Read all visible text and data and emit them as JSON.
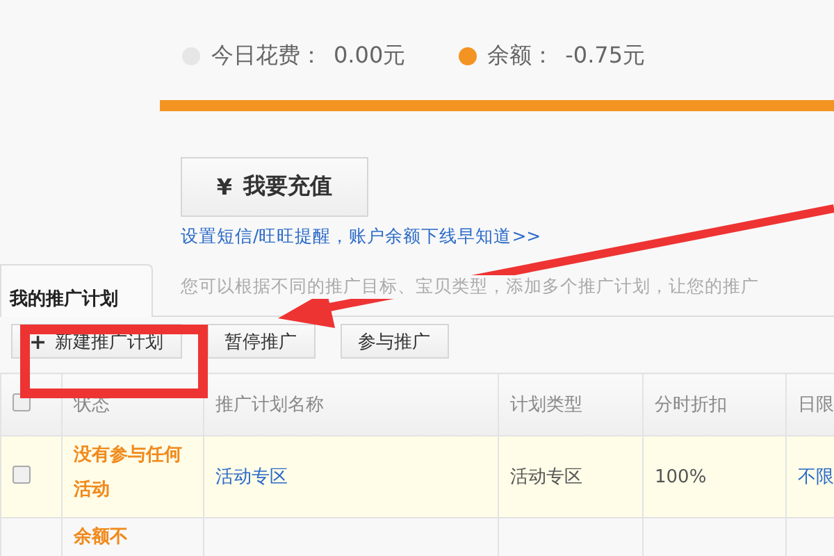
{
  "stats": [
    {
      "label": "今日花费：",
      "value": "0.00元",
      "color": "#e6e6e6"
    },
    {
      "label": "余额：",
      "value": "-0.75元",
      "color": "#f39422"
    }
  ],
  "recharge_button": {
    "icon": "¥",
    "label": "我要充值"
  },
  "reminder_link": "设置短信/旺旺提醒，账户余额下线早知道>>",
  "tabs": [
    {
      "label": "我的推广计划",
      "selected": true
    }
  ],
  "tab_hint": "您可以根据不同的推广目标、宝贝类型，添加多个推广计划，让您的推广",
  "toolbar": [
    {
      "icon": "+",
      "label": "新建推广计划"
    },
    {
      "label": "暂停推广"
    },
    {
      "label": "参与推广"
    }
  ],
  "table": {
    "select_all_checked": false,
    "columns": [
      "状态",
      "推广计划名称",
      "计划类型",
      "分时折扣",
      "日限"
    ],
    "rows": [
      {
        "checked": false,
        "status": "没有参与任何活动",
        "name": "活动专区",
        "type": "活动专区",
        "discount": "100%",
        "daily_limit": "不限"
      },
      {
        "status": "余额不"
      }
    ]
  }
}
